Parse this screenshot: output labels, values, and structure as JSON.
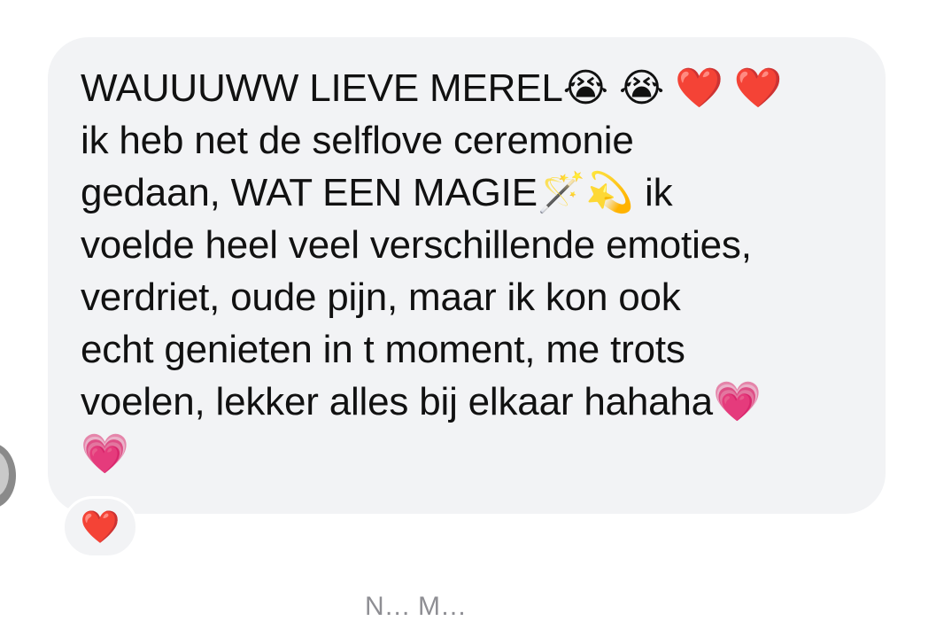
{
  "message": {
    "lines": [
      "WAUUUWW LIEVE MEREL😭 😭 ❤️ ❤️",
      "ik heb net de selflove ceremonie",
      "gedaan, WAT EEN MAGIE🪄💫 ik",
      "voelde heel veel verschillende emoties,",
      "verdriet, oude pijn, maar ik kon ook",
      "echt genieten in t moment, me trots",
      "voelen, lekker alles bij elkaar hahaha💗",
      "💗"
    ]
  },
  "reaction": {
    "emoji": "❤️"
  },
  "next_sender": {
    "label": "N… M…"
  }
}
